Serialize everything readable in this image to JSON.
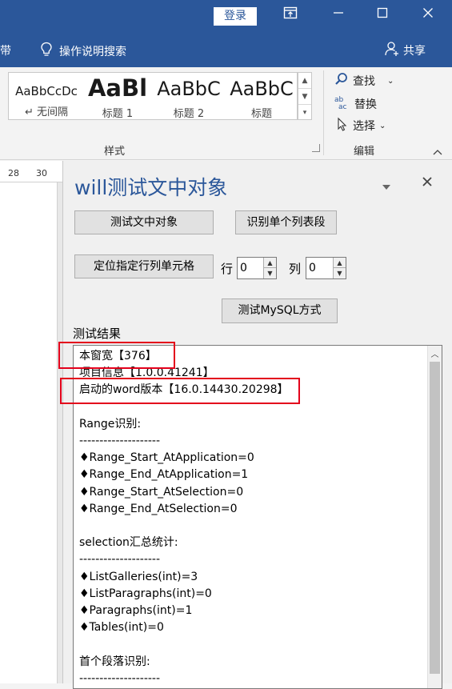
{
  "titlebar": {
    "login_label": "登录",
    "accent": "#2b579a"
  },
  "menubar": {
    "tab_fragment": "带",
    "tellme_label": "操作说明搜索",
    "share_label": "共享"
  },
  "ribbon": {
    "styles": [
      {
        "preview": "AaBbCcDc",
        "label": "↵ 无间隔"
      },
      {
        "preview": "AaBl",
        "label": "标题 1"
      },
      {
        "preview": "AaBbC",
        "label": "标题 2"
      },
      {
        "preview": "AaBbC",
        "label": "标题"
      }
    ],
    "styles_group_label": "样式",
    "find_label": "查找",
    "replace_label": "替换",
    "select_label": "选择",
    "edit_group_label": "编辑"
  },
  "ruler": {
    "mark_28": "28",
    "mark_30": "30"
  },
  "pane": {
    "title": "will测试文中对象",
    "btn_test_objects": "测试文中对象",
    "btn_identify_list": "识别单个列表段",
    "btn_locate_cell": "定位指定行列单元格",
    "row_label": "行",
    "row_value": "0",
    "col_label": "列",
    "col_value": "0",
    "btn_mysql": "测试MySQL方式",
    "result_title": "测试结果",
    "result_lines": [
      "本窗宽【376】",
      "项目信息【1.0.0.41241】",
      "启动的word版本【16.0.14430.20298】",
      "",
      "Range识别:",
      "--------------------",
      "♦Range_Start_AtApplication=0",
      "♦Range_End_AtApplication=1",
      "♦Range_Start_AtSelection=0",
      "♦Range_End_AtSelection=0",
      "",
      "selection汇总统计:",
      "--------------------",
      "♦ListGalleries(int)=3",
      "♦ListParagraphs(int)=0",
      "♦Paragraphs(int)=1",
      "♦Tables(int)=0",
      "",
      "首个段落识别:",
      "--------------------"
    ]
  }
}
